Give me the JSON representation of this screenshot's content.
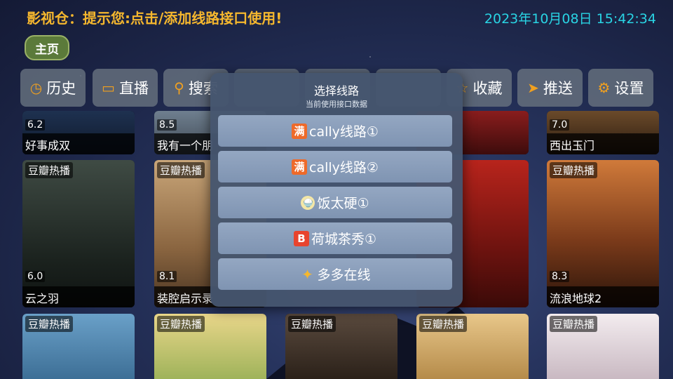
{
  "header": {
    "app_title": "影视仓：提示您:点击/添加线路接口使用!",
    "datetime": "2023年10月08日 15:42:34"
  },
  "home_tab": "主页",
  "nav": [
    {
      "label": "历史",
      "icon": "clock-icon",
      "glyph": "◷"
    },
    {
      "label": "直播",
      "icon": "tv-icon",
      "glyph": "▭"
    },
    {
      "label": "搜索",
      "icon": "search-icon",
      "glyph": "⚲"
    },
    {
      "label": "",
      "icon": "",
      "glyph": ""
    },
    {
      "label": "",
      "icon": "",
      "glyph": ""
    },
    {
      "label": "",
      "icon": "",
      "glyph": ""
    },
    {
      "label": "收藏",
      "icon": "star-icon",
      "glyph": "☆"
    },
    {
      "label": "推送",
      "icon": "send-icon",
      "glyph": "➤"
    },
    {
      "label": "设置",
      "icon": "gear-icon",
      "glyph": "⚙"
    }
  ],
  "dialog": {
    "title": "选择线路",
    "subtitle": "当前使用接口数据",
    "routes": [
      {
        "label": "cally线路①",
        "icon": "man-icon",
        "glyph": "满"
      },
      {
        "label": "cally线路②",
        "icon": "man-icon",
        "glyph": "满"
      },
      {
        "label": "饭太硬①",
        "icon": "rice-bowl-icon",
        "glyph": "🍚"
      },
      {
        "label": "荷城茶秀①",
        "icon": "b-icon",
        "glyph": "B"
      },
      {
        "label": "多多在线",
        "icon": "sparkle-icon",
        "glyph": "✦"
      }
    ]
  },
  "rows": [
    [
      {
        "title": "好事成双",
        "rating": "6.2",
        "badge": ""
      },
      {
        "title": "我有一个朋",
        "rating": "8.5",
        "badge": ""
      },
      {
        "title": "",
        "rating": "",
        "badge": ""
      },
      {
        "title": "",
        "rating": "",
        "badge": ""
      },
      {
        "title": "西出玉门",
        "rating": "7.0",
        "badge": ""
      }
    ],
    [
      {
        "title": "云之羽",
        "rating": "6.0",
        "badge": "豆瓣热播"
      },
      {
        "title": "装腔启示录",
        "rating": "8.1",
        "badge": "豆瓣热播"
      },
      {
        "title": "",
        "rating": "",
        "badge": ""
      },
      {
        "title": "",
        "rating": "",
        "badge": ""
      },
      {
        "title": "流浪地球2",
        "rating": "8.3",
        "badge": "豆瓣热播"
      }
    ],
    [
      {
        "title": "",
        "rating": "",
        "badge": "豆瓣热播"
      },
      {
        "title": "",
        "rating": "",
        "badge": "豆瓣热播"
      },
      {
        "title": "",
        "rating": "",
        "badge": "豆瓣热播"
      },
      {
        "title": "",
        "rating": "",
        "badge": "豆瓣热播"
      },
      {
        "title": "",
        "rating": "",
        "badge": "豆瓣热播"
      }
    ]
  ]
}
